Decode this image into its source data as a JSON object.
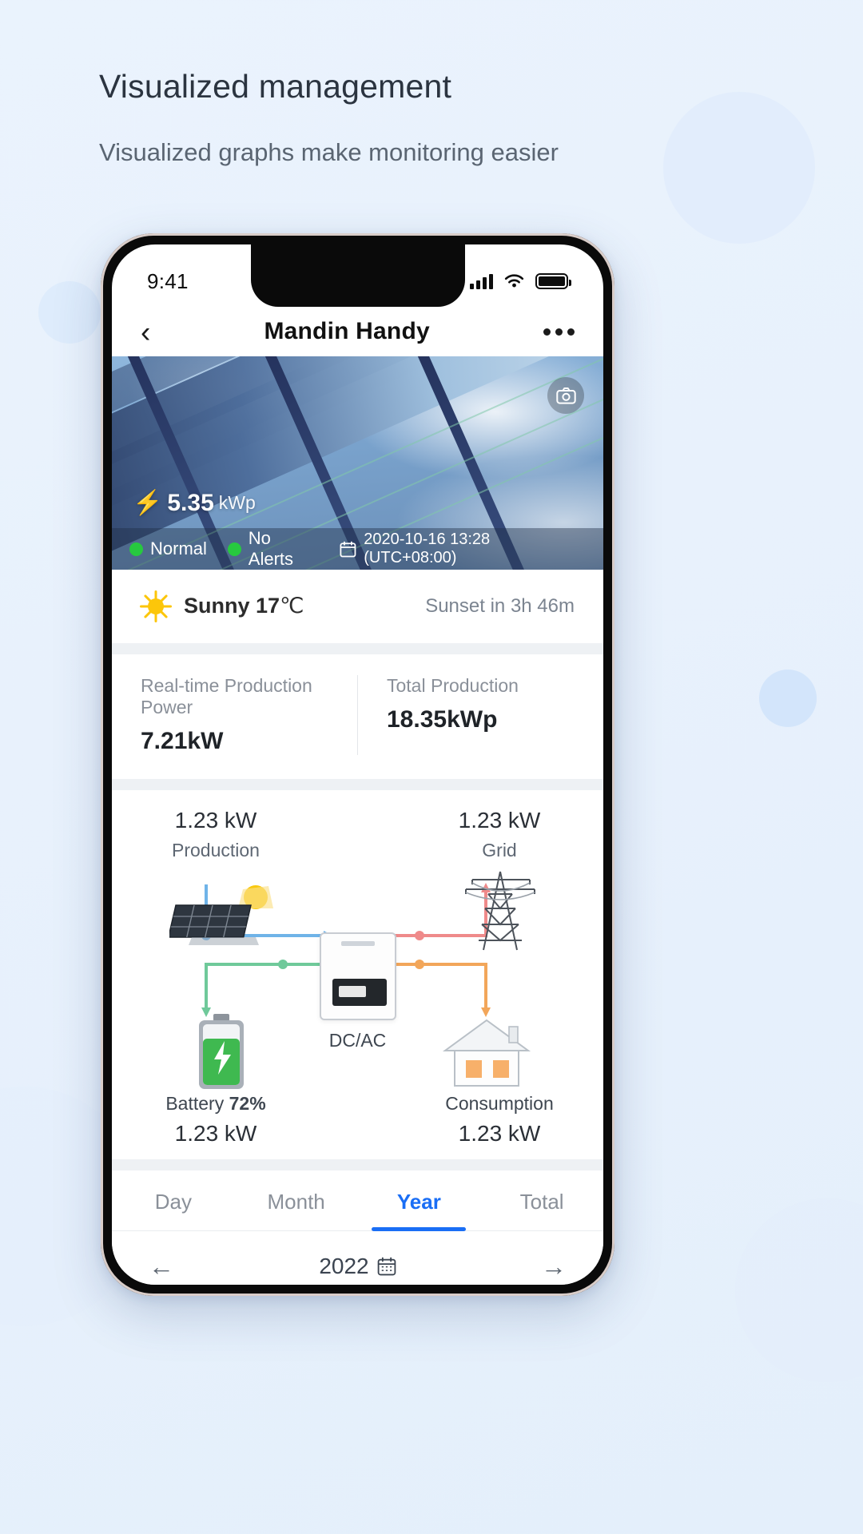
{
  "promo": {
    "title": "Visualized management",
    "subtitle": "Visualized graphs make monitoring easier"
  },
  "phone": {
    "status_bar": {
      "time": "9:41",
      "signal_icon": "signal-bars-icon",
      "wifi_icon": "wifi-icon",
      "battery_icon": "battery-full-icon"
    },
    "navbar": {
      "back_icon": "chevron-left-icon",
      "title": "Mandin Handy",
      "more_icon": "more-options-icon"
    },
    "hero": {
      "camera_icon": "camera-icon",
      "capacity_value": "5.35",
      "capacity_unit": "kWp",
      "bolt_icon": "lightning-bolt-icon",
      "status_normal": "Normal",
      "status_alerts": "No Alerts",
      "calendar_icon": "calendar-icon",
      "timestamp": "2020-10-16 13:28 (UTC+08:00)"
    },
    "weather": {
      "icon": "sun-icon",
      "condition": "Sunny",
      "temperature": "17",
      "temperature_unit": "℃",
      "sunset": "Sunset in 3h 46m"
    },
    "stats": [
      {
        "label": "Real-time Production Power",
        "value": "7.21kW"
      },
      {
        "label": "Total Production",
        "value": "18.35kWp"
      }
    ],
    "flow": {
      "production": {
        "value": "1.23 kW",
        "label": "Production"
      },
      "grid": {
        "value": "1.23 kW",
        "label": "Grid"
      },
      "battery": {
        "label_prefix": "Battery ",
        "label_percent": "72%",
        "value": "1.23 kW"
      },
      "consumption": {
        "label": "Consumption",
        "value": "1.23 kW"
      },
      "inverter_caption": "DC/AC",
      "colors": {
        "production_line": "#6fb3e8",
        "battery_line": "#6fc99a",
        "grid_line": "#ef8a8a",
        "consumption_line": "#f2a65a"
      }
    },
    "tabs": [
      {
        "label": "Day",
        "active": false
      },
      {
        "label": "Month",
        "active": false
      },
      {
        "label": "Year",
        "active": true
      },
      {
        "label": "Total",
        "active": false
      }
    ],
    "year_bar": {
      "prev_icon": "arrow-left-icon",
      "year": "2022",
      "calendar_icon": "calendar-icon",
      "next_icon": "arrow-right-icon"
    }
  },
  "theme": {
    "accent": "#1a6ef5",
    "status_green": "#27c93f",
    "sun_yellow": "#fcc60a",
    "page_bg": "#eaf3fd"
  }
}
